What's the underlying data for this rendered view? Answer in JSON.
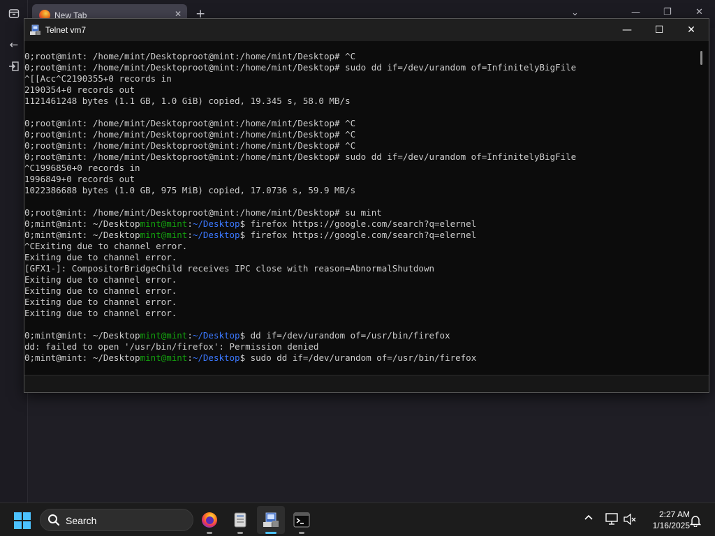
{
  "browser": {
    "tab_title": "New Tab",
    "tab_close": "✕",
    "new_tab": "+",
    "tab_list": "⌄"
  },
  "window": {
    "title": "Telnet vm7",
    "minimize": "—",
    "maximize": "☐",
    "close": "✕"
  },
  "terminal": {
    "lines": [
      [
        {
          "t": "0;root@mint: /home/mint/Desktoproot@mint:/home/mint/Desktop# ^C",
          "c": ""
        }
      ],
      [
        {
          "t": "0;root@mint: /home/mint/Desktoproot@mint:/home/mint/Desktop# sudo dd if=/dev/urandom of=InfinitelyBigFile",
          "c": ""
        }
      ],
      [
        {
          "t": "^[[Acc^C2190355+0 records in",
          "c": ""
        }
      ],
      [
        {
          "t": "2190354+0 records out",
          "c": ""
        }
      ],
      [
        {
          "t": "1121461248 bytes (1.1 GB, 1.0 GiB) copied, 19.345 s, 58.0 MB/s",
          "c": ""
        }
      ],
      [
        {
          "t": "",
          "c": ""
        }
      ],
      [
        {
          "t": "0;root@mint: /home/mint/Desktoproot@mint:/home/mint/Desktop# ^C",
          "c": ""
        }
      ],
      [
        {
          "t": "0;root@mint: /home/mint/Desktoproot@mint:/home/mint/Desktop# ^C",
          "c": ""
        }
      ],
      [
        {
          "t": "0;root@mint: /home/mint/Desktoproot@mint:/home/mint/Desktop# ^C",
          "c": ""
        }
      ],
      [
        {
          "t": "0;root@mint: /home/mint/Desktoproot@mint:/home/mint/Desktop# sudo dd if=/dev/urandom of=InfinitelyBigFile",
          "c": ""
        }
      ],
      [
        {
          "t": "^C1996850+0 records in",
          "c": ""
        }
      ],
      [
        {
          "t": "1996849+0 records out",
          "c": ""
        }
      ],
      [
        {
          "t": "1022386688 bytes (1.0 GB, 975 MiB) copied, 17.0736 s, 59.9 MB/s",
          "c": ""
        }
      ],
      [
        {
          "t": "",
          "c": ""
        }
      ],
      [
        {
          "t": "0;root@mint: /home/mint/Desktoproot@mint:/home/mint/Desktop# su mint",
          "c": ""
        }
      ],
      [
        {
          "t": "0;mint@mint: ~/Desktop",
          "c": ""
        },
        {
          "t": "mint@mint",
          "c": "green"
        },
        {
          "t": ":",
          "c": ""
        },
        {
          "t": "~/Desktop",
          "c": "blue"
        },
        {
          "t": "$ firefox https://google.com/search?q=elernel",
          "c": ""
        }
      ],
      [
        {
          "t": "0;mint@mint: ~/Desktop",
          "c": ""
        },
        {
          "t": "mint@mint",
          "c": "green"
        },
        {
          "t": ":",
          "c": ""
        },
        {
          "t": "~/Desktop",
          "c": "blue"
        },
        {
          "t": "$ firefox https://google.com/search?q=elernel",
          "c": ""
        }
      ],
      [
        {
          "t": "^CExiting due to channel error.",
          "c": ""
        }
      ],
      [
        {
          "t": "Exiting due to channel error.",
          "c": ""
        }
      ],
      [
        {
          "t": "[GFX1-]: CompositorBridgeChild receives IPC close with reason=AbnormalShutdown",
          "c": ""
        }
      ],
      [
        {
          "t": "Exiting due to channel error.",
          "c": ""
        }
      ],
      [
        {
          "t": "Exiting due to channel error.",
          "c": ""
        }
      ],
      [
        {
          "t": "Exiting due to channel error.",
          "c": ""
        }
      ],
      [
        {
          "t": "Exiting due to channel error.",
          "c": ""
        }
      ],
      [
        {
          "t": "",
          "c": ""
        }
      ],
      [
        {
          "t": "0;mint@mint: ~/Desktop",
          "c": ""
        },
        {
          "t": "mint@mint",
          "c": "green"
        },
        {
          "t": ":",
          "c": ""
        },
        {
          "t": "~/Desktop",
          "c": "blue"
        },
        {
          "t": "$ dd if=/dev/urandom of=/usr/bin/firefox",
          "c": ""
        }
      ],
      [
        {
          "t": "dd: failed to open '/usr/bin/firefox': Permission denied",
          "c": ""
        }
      ],
      [
        {
          "t": "0;mint@mint: ~/Desktop",
          "c": ""
        },
        {
          "t": "mint@mint",
          "c": "green"
        },
        {
          "t": ":",
          "c": ""
        },
        {
          "t": "~/Desktop",
          "c": "blue"
        },
        {
          "t": "$ sudo dd if=/dev/urandom of=/usr/bin/firefox",
          "c": ""
        }
      ]
    ]
  },
  "taskbar": {
    "search_placeholder": "Search",
    "time": "2:27 AM",
    "date": "1/16/2025",
    "tray_chevron": "^",
    "apps": [
      "firefox-icon",
      "files-icon",
      "telnet-icon",
      "terminal-icon"
    ]
  },
  "colors": {
    "prompt_user": "#13a10e",
    "prompt_path": "#3b78ff",
    "start_accent": "#4cc2ff"
  }
}
